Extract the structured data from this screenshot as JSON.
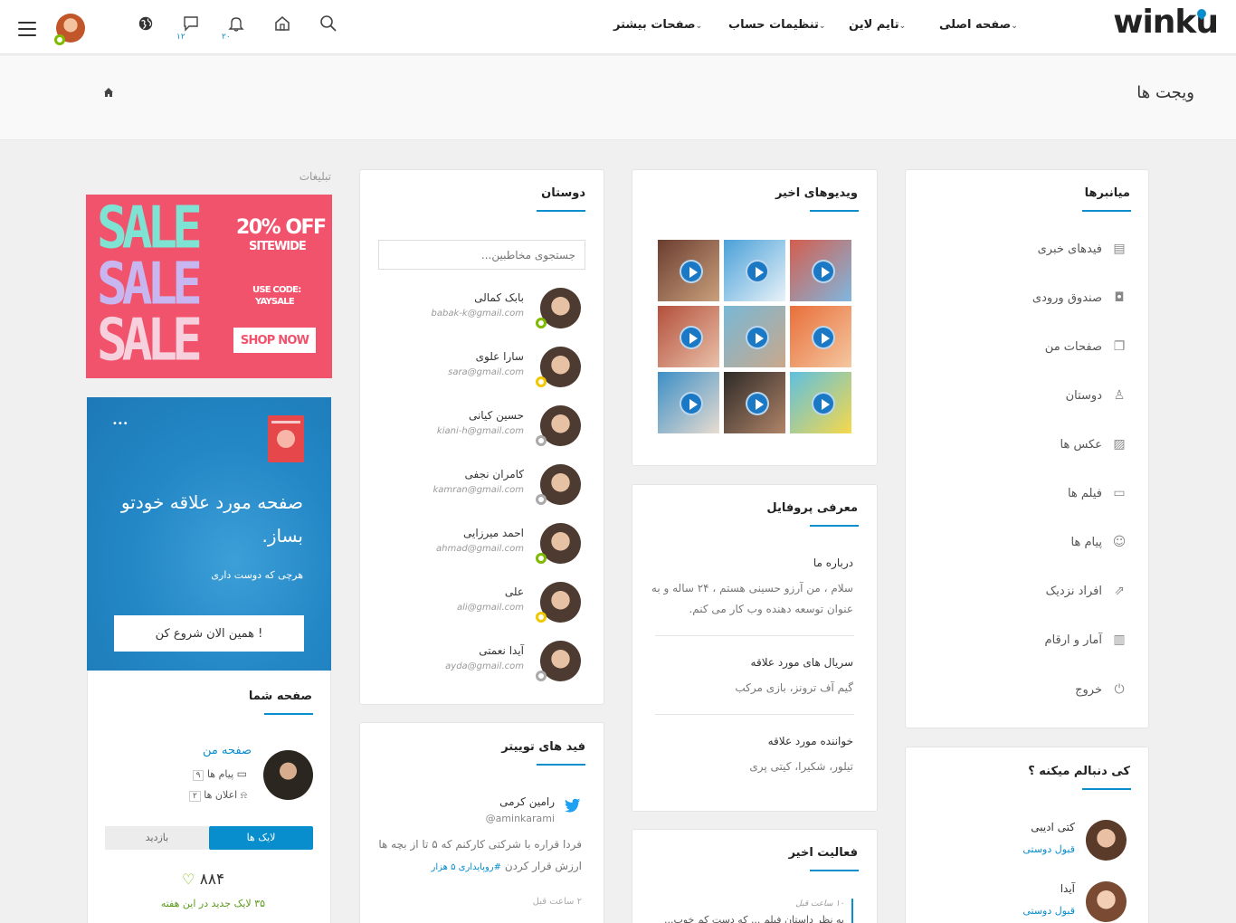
{
  "brand": {
    "logo_text": "winku",
    "accent": "#088dcd"
  },
  "topnav": {
    "items": [
      "صفحه اصلی",
      "تایم لاین",
      "تنظیمات حساب",
      "صفحات بیشتر"
    ],
    "messages_count": "۱۲",
    "notifications_count": "۲۰"
  },
  "page": {
    "title": "ویجت ها"
  },
  "shortcuts": {
    "title": "میانبرها",
    "items": [
      {
        "label": "فیدهای خبری",
        "icon": "clipboard-icon"
      },
      {
        "label": "صندوق ورودی",
        "icon": "mouse-icon"
      },
      {
        "label": "صفحات من",
        "icon": "files-icon"
      },
      {
        "label": "دوستان",
        "icon": "user-icon"
      },
      {
        "label": "عکس ها",
        "icon": "image-icon"
      },
      {
        "label": "فیلم ها",
        "icon": "video-icon"
      },
      {
        "label": "پیام ها",
        "icon": "chat-icon"
      },
      {
        "label": "افراد نزدیک",
        "icon": "share-icon"
      },
      {
        "label": "آمار و ارقام",
        "icon": "stats-icon"
      },
      {
        "label": "خروج",
        "icon": "power-icon"
      }
    ]
  },
  "followers": {
    "title": "کی دنبالم میکنه ؟",
    "items": [
      {
        "name": "کتی ادیبی",
        "action": "قبول دوستی"
      },
      {
        "name": "آیدا",
        "action": "قبول دوستی"
      }
    ]
  },
  "videos": {
    "title": "ویدیوهای اخیر"
  },
  "profile_intro": {
    "title": "معرفی پروفایل",
    "sections": [
      {
        "heading": "درباره ما",
        "text_line1": "سلام ، من آرزو حسینی هستم ، ۲۴ ساله و به",
        "text_line2": "عنوان توسعه دهنده وب کار می کنم."
      },
      {
        "heading": "سریال های مورد علاقه",
        "text_line1": "گیم آف ترونز، بازی مرکب"
      },
      {
        "heading": "خواننده مورد علاقه",
        "text_line1": "تیلور، شکیرا، کیتی پری"
      }
    ]
  },
  "recent_activity": {
    "title": "فعالیت اخیر",
    "time": "۱۰ ساعت قبل",
    "text": "به نظر داستان فیلم ... که دست کم خوب..."
  },
  "friends": {
    "title": "دوستان",
    "search_placeholder": "جستجوی مخاطبین...",
    "items": [
      {
        "name": "بابک کمالی",
        "email": "babak-k@gmail.com",
        "status_color": "#7fba00"
      },
      {
        "name": "سارا علوی",
        "email": "sara@gmail.com",
        "status_color": "#f0c800"
      },
      {
        "name": "حسین کیانی",
        "email": "kiani-h@gmail.com",
        "status_color": "#aaaaaa"
      },
      {
        "name": "کامران نجفی",
        "email": "kamran@gmail.com",
        "status_color": "#aaaaaa"
      },
      {
        "name": "احمد میرزایی",
        "email": "ahmad@gmail.com",
        "status_color": "#7fba00"
      },
      {
        "name": "علی",
        "email": "ali@gmail.com",
        "status_color": "#f0c800"
      },
      {
        "name": "آیدا نعمتی",
        "email": "ayda@gmail.com",
        "status_color": "#aaaaaa"
      }
    ]
  },
  "twitter": {
    "title": "فید های توییتر",
    "name": "رامین کرمی",
    "handle": "@aminkarami",
    "text_line1": "فردا قراره با شرکتی کارکنم که ۵ تا از بچه ها",
    "text_line2": "ارزش قرار کردن",
    "hashtag": "#روپایداری ۵ هزار",
    "time": "۲ ساعت قبل"
  },
  "ads": {
    "label": "تبلیغات",
    "sale_word": "SALE",
    "discount": "20% OFF",
    "sitewide": "SITEWIDE",
    "use_code": "USE CODE:",
    "code": "YAYSALE",
    "shop_now": "SHOP NOW"
  },
  "promo": {
    "more": "•••",
    "headline_line1": "صفحه مورد علاقه خودتو",
    "headline_line2": "بساز.",
    "sub": "هرچی که دوست داری",
    "cta": "همین الان شروع کن !"
  },
  "your_page": {
    "title": "صفحه شما",
    "page_name": "صفحه من",
    "messages_label": "پیام ها",
    "messages_count": "۹",
    "notifications_label": "اعلان ها",
    "notifications_count": "۲",
    "tab_likes": "لایک ها",
    "tab_visits": "بازدید",
    "likes": "۸۸۴",
    "new_likes": "۳۵ لایک جدید در این هفته"
  }
}
